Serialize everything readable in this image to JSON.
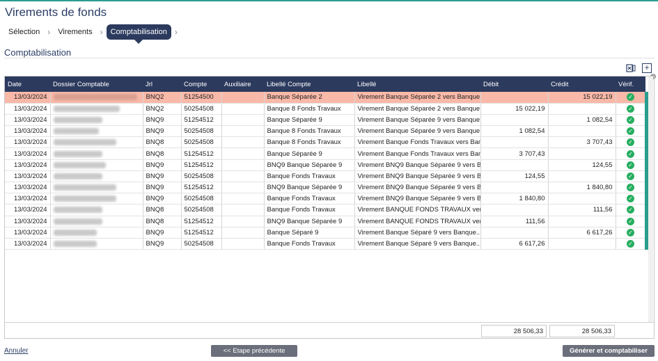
{
  "page": {
    "title": "Virements de fonds",
    "section_title": "Comptabilisation"
  },
  "breadcrumb": {
    "step1": "Sélection",
    "step2": "Virements",
    "step3": "Comptabilisation",
    "sep": "›"
  },
  "toolbar": {
    "excel_icon": "excel-export-icon",
    "expand_icon": "expand-icon"
  },
  "columns": [
    "Date",
    "Dossier Comptable",
    "Jrl",
    "Compte",
    "Auxiliaire",
    "Libellé Compte",
    "Libellé",
    "Débit",
    "Crédit",
    "Vérif."
  ],
  "rows": [
    {
      "date": "13/03/2024",
      "jrl": "BNQ2",
      "compte": "51254500",
      "auxiliaire": "",
      "libelle_compte": "Banque Séparée 2",
      "libelle": "Virement Banque Séparée 2 vers Banque...",
      "debit": "",
      "credit": "15 022,19",
      "selected": true
    },
    {
      "date": "13/03/2024",
      "jrl": "BNQ2",
      "compte": "50254508",
      "auxiliaire": "",
      "libelle_compte": "Banque 8 Fonds Travaux",
      "libelle": "Virement Banque Séparée 2 vers Banque...",
      "debit": "15 022,19",
      "credit": ""
    },
    {
      "date": "13/03/2024",
      "jrl": "BNQ9",
      "compte": "51254512",
      "auxiliaire": "",
      "libelle_compte": "Banque Séparée 9",
      "libelle": "Virement Banque Séparée 9 vers Banque...",
      "debit": "",
      "credit": "1 082,54"
    },
    {
      "date": "13/03/2024",
      "jrl": "BNQ9",
      "compte": "50254508",
      "auxiliaire": "",
      "libelle_compte": "Banque 8 Fonds Travaux",
      "libelle": "Virement Banque Séparée 9 vers Banque...",
      "debit": "1 082,54",
      "credit": ""
    },
    {
      "date": "13/03/2024",
      "jrl": "BNQ8",
      "compte": "50254508",
      "auxiliaire": "",
      "libelle_compte": "Banque 8 Fonds Travaux",
      "libelle": "Virement Banque Fonds Travaux vers Ban...",
      "debit": "",
      "credit": "3 707,43"
    },
    {
      "date": "13/03/2024",
      "jrl": "BNQ8",
      "compte": "51254512",
      "auxiliaire": "",
      "libelle_compte": "Banque Séparée 9",
      "libelle": "Virement Banque Fonds Travaux vers Ban...",
      "debit": "3 707,43",
      "credit": ""
    },
    {
      "date": "13/03/2024",
      "jrl": "BNQ9",
      "compte": "51254512",
      "auxiliaire": "",
      "libelle_compte": "BNQ9 Banque Séparée 9",
      "libelle": "Virement BNQ9 Banque Séparée 9 vers B...",
      "debit": "",
      "credit": "124,55"
    },
    {
      "date": "13/03/2024",
      "jrl": "BNQ9",
      "compte": "50254508",
      "auxiliaire": "",
      "libelle_compte": "Banque Fonds Travaux",
      "libelle": "Virement BNQ9 Banque Séparée 9 vers B...",
      "debit": "124,55",
      "credit": ""
    },
    {
      "date": "13/03/2024",
      "jrl": "BNQ9",
      "compte": "51254512",
      "auxiliaire": "",
      "libelle_compte": "BNQ9 Banque Séparée 9",
      "libelle": "Virement BNQ9 Banque Séparée 9 vers B...",
      "debit": "",
      "credit": "1 840,80"
    },
    {
      "date": "13/03/2024",
      "jrl": "BNQ9",
      "compte": "50254508",
      "auxiliaire": "",
      "libelle_compte": "Banque Fonds Travaux",
      "libelle": "Virement BNQ9 Banque Séparée 9 vers B...",
      "debit": "1 840,80",
      "credit": ""
    },
    {
      "date": "13/03/2024",
      "jrl": "BNQ8",
      "compte": "50254508",
      "auxiliaire": "",
      "libelle_compte": "Banque Fonds Travaux",
      "libelle": "Virement BANQUE FONDS TRAVAUX ver...",
      "debit": "",
      "credit": "111,56"
    },
    {
      "date": "13/03/2024",
      "jrl": "BNQ8",
      "compte": "51254512",
      "auxiliaire": "",
      "libelle_compte": "BNQ9 Banque Séparée 9",
      "libelle": "Virement BANQUE FONDS TRAVAUX ver...",
      "debit": "111,56",
      "credit": ""
    },
    {
      "date": "13/03/2024",
      "jrl": "BNQ9",
      "compte": "51254512",
      "auxiliaire": "",
      "libelle_compte": "Banque Séparé 9",
      "libelle": "Virement Banque Séparé 9 vers Banque...",
      "debit": "",
      "credit": "6 617,26"
    },
    {
      "date": "13/03/2024",
      "jrl": "BNQ9",
      "compte": "50254508",
      "auxiliaire": "",
      "libelle_compte": "Banque Fonds Travaux",
      "libelle": "Virement Banque Séparé 9 vers Banque...",
      "debit": "6 617,26",
      "credit": ""
    }
  ],
  "totals": {
    "debit": "28 506,33",
    "credit": "28 506,33"
  },
  "footer": {
    "cancel_label": "Annuler",
    "prev_label": "<< Etape précédente",
    "generate_label": "Générer et comptabiliser"
  },
  "colors": {
    "header_bg": "#2c3a5e",
    "selected_row": "#f9b9a8",
    "accent": "#2a9d8f",
    "check": "#27ae60"
  }
}
